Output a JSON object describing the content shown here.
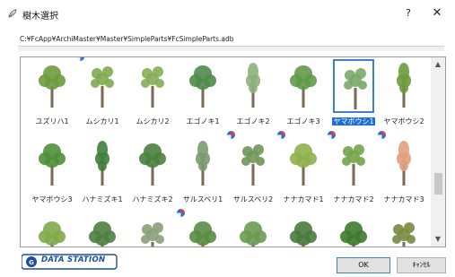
{
  "window": {
    "title": "樹木選択",
    "help_label": "?",
    "close_label": "✕"
  },
  "path": "C:¥FcApp¥ArchiMaster¥Master¥SimpleParts¥FcSimpleParts.adb",
  "items": [
    {
      "label": "ユズリハ1",
      "badge": false,
      "selected": false,
      "color": "#6e9b3f",
      "shape": "round"
    },
    {
      "label": "ムシカリ1",
      "badge": true,
      "selected": false,
      "color": "#7fa84e",
      "shape": "sparse"
    },
    {
      "label": "ムシカリ2",
      "badge": false,
      "selected": false,
      "color": "#86ad55",
      "shape": "sparse"
    },
    {
      "label": "エゴノキ1",
      "badge": false,
      "selected": false,
      "color": "#4f8a4a",
      "shape": "round"
    },
    {
      "label": "エゴノキ2",
      "badge": false,
      "selected": false,
      "color": "#8cb07a",
      "shape": "slim"
    },
    {
      "label": "エゴノキ3",
      "badge": false,
      "selected": false,
      "color": "#5f9a48",
      "shape": "round"
    },
    {
      "label": "ヤマボウシ1",
      "badge": false,
      "selected": true,
      "color": "#7aa868",
      "shape": "sparse"
    },
    {
      "label": "ヤマボウシ2",
      "badge": false,
      "selected": false,
      "color": "#6c9a3c",
      "shape": "slim"
    },
    {
      "label": "ヤマボウシ3",
      "badge": false,
      "selected": false,
      "color": "#4f8f3a",
      "shape": "round"
    },
    {
      "label": "ハナミズキ1",
      "badge": false,
      "selected": false,
      "color": "#3f7e38",
      "shape": "slim"
    },
    {
      "label": "ハナミズキ2",
      "badge": false,
      "selected": false,
      "color": "#4a7f3c",
      "shape": "round"
    },
    {
      "label": "サルスベリ1",
      "badge": false,
      "selected": false,
      "color": "#7a9a70",
      "shape": "slim"
    },
    {
      "label": "サルスベリ2",
      "badge": true,
      "selected": false,
      "color": "#6f9658",
      "shape": "sparse"
    },
    {
      "label": "ナナカマド1",
      "badge": true,
      "selected": false,
      "color": "#8fb04a",
      "shape": "round"
    },
    {
      "label": "ナナカマド2",
      "badge": true,
      "selected": false,
      "color": "#74a449",
      "shape": "sparse"
    },
    {
      "label": "ナナカマド3",
      "badge": true,
      "selected": false,
      "color": "#e0a080",
      "shape": "slim"
    },
    {
      "label": "",
      "badge": false,
      "selected": false,
      "color": "#7faa4a",
      "shape": "round"
    },
    {
      "label": "",
      "badge": false,
      "selected": false,
      "color": "#4f7f40",
      "shape": "round"
    },
    {
      "label": "",
      "badge": false,
      "selected": false,
      "color": "#8aa07a",
      "shape": "sparse"
    },
    {
      "label": "",
      "badge": true,
      "selected": false,
      "color": "#5b8c44",
      "shape": "round"
    },
    {
      "label": "",
      "badge": false,
      "selected": false,
      "color": "#6a9a50",
      "shape": "round"
    },
    {
      "label": "",
      "badge": false,
      "selected": false,
      "color": "#4a7a3c",
      "shape": "round"
    },
    {
      "label": "",
      "badge": false,
      "selected": false,
      "color": "#3f7a2e",
      "shape": "round"
    },
    {
      "label": "",
      "badge": false,
      "selected": false,
      "color": "#7a8a40",
      "shape": "sparse"
    }
  ],
  "logo_text": "DATA STATION",
  "ok_label": "OK",
  "cancel_label": "ｷｬﾝｾﾙ"
}
